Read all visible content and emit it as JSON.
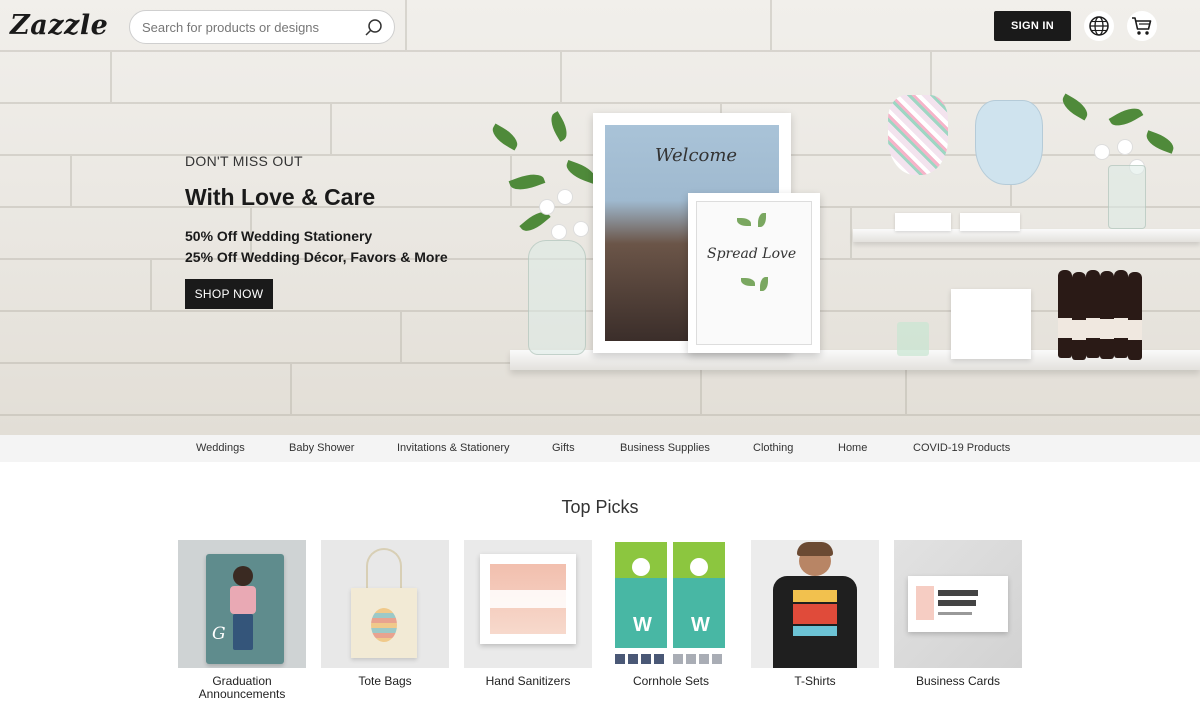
{
  "header": {
    "logo": "Zazzle",
    "search_placeholder": "Search for products or designs",
    "signin_label": "SIGN IN"
  },
  "icons": {
    "search": "search-icon",
    "globe": "globe-icon",
    "cart": "cart-icon"
  },
  "hero": {
    "eyebrow": "DON'T MISS OUT",
    "headline": "With Love & Care",
    "promo_line1": "50% Off Wedding Stationery",
    "promo_line2": "25% Off Wedding Décor, Favors & More",
    "cta": "SHOP NOW",
    "frame1_text": "Welcome",
    "frame2_text": "Spread Love"
  },
  "categories": [
    "Weddings",
    "Baby Shower",
    "Invitations & Stationery",
    "Gifts",
    "Business Supplies",
    "Clothing",
    "Home",
    "COVID-19 Products"
  ],
  "top_picks": {
    "title": "Top Picks",
    "items": [
      {
        "label": "Graduation Announcements"
      },
      {
        "label": "Tote Bags"
      },
      {
        "label": "Hand Sanitizers"
      },
      {
        "label": "Cornhole Sets"
      },
      {
        "label": "T-Shirts"
      },
      {
        "label": "Business Cards"
      }
    ]
  },
  "colors": {
    "dark": "#1a1a1a",
    "nav_bg": "#f4f4f4",
    "hero_bg": "#ece9e4"
  }
}
